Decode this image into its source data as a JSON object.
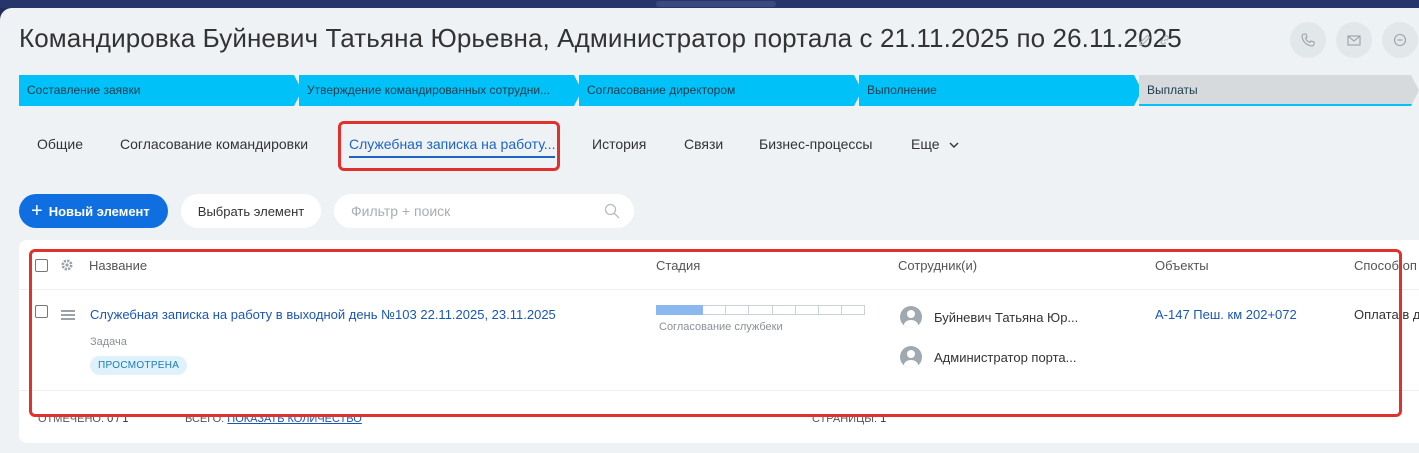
{
  "header": {
    "title": "Командировка Буйневич Татьяна Юрьевна, Администратор портала с 21.11.2025 по 26.11.2025"
  },
  "stages": [
    {
      "label": "Составление заявки",
      "state": "done"
    },
    {
      "label": "Утверждение командированных сотрудни...",
      "state": "done"
    },
    {
      "label": "Согласование директором",
      "state": "done"
    },
    {
      "label": "Выполнение",
      "state": "done"
    },
    {
      "label": "Выплаты",
      "state": "pending"
    }
  ],
  "tabs": [
    {
      "label": "Общие"
    },
    {
      "label": "Согласование командировки"
    },
    {
      "label": "Служебная записка на работу..."
    },
    {
      "label": "История"
    },
    {
      "label": "Связи"
    },
    {
      "label": "Бизнес-процессы"
    },
    {
      "label": "Еще"
    }
  ],
  "toolbar": {
    "new_label": "Новый элемент",
    "pick_label": "Выбрать элемент",
    "search_placeholder": "Фильтр + поиск"
  },
  "grid": {
    "columns": [
      "Название",
      "Стадия",
      "Сотрудник(и)",
      "Объекты",
      "Способ оп"
    ],
    "rows": [
      {
        "title": "Служебная записка на работу в выходной день №103 22.11.2025, 23.11.2025",
        "type": "Задача",
        "badge": "ПРОСМОТРЕНА",
        "stage_label": "Согласование службеки",
        "stage_progress": "2 of 9",
        "employees": [
          "Буйневич Татьяна Юр...",
          "Администратор порта..."
        ],
        "object": "А-147 Пеш. км 202+072",
        "payment": "Оплата в д"
      }
    ]
  },
  "footer": {
    "selected_label": "ОТМЕЧЕНО:",
    "selected_value": "0 / 1",
    "total_label": "ВСЕГО:",
    "total_link": "ПОКАЗАТЬ КОЛИЧЕСТВО",
    "pages_label": "СТРАНИЦЫ:",
    "pages_value": "1"
  },
  "colors": {
    "accent": "#0f6fe0",
    "stage_done": "#00c2f8",
    "highlight": "#e0312c"
  }
}
